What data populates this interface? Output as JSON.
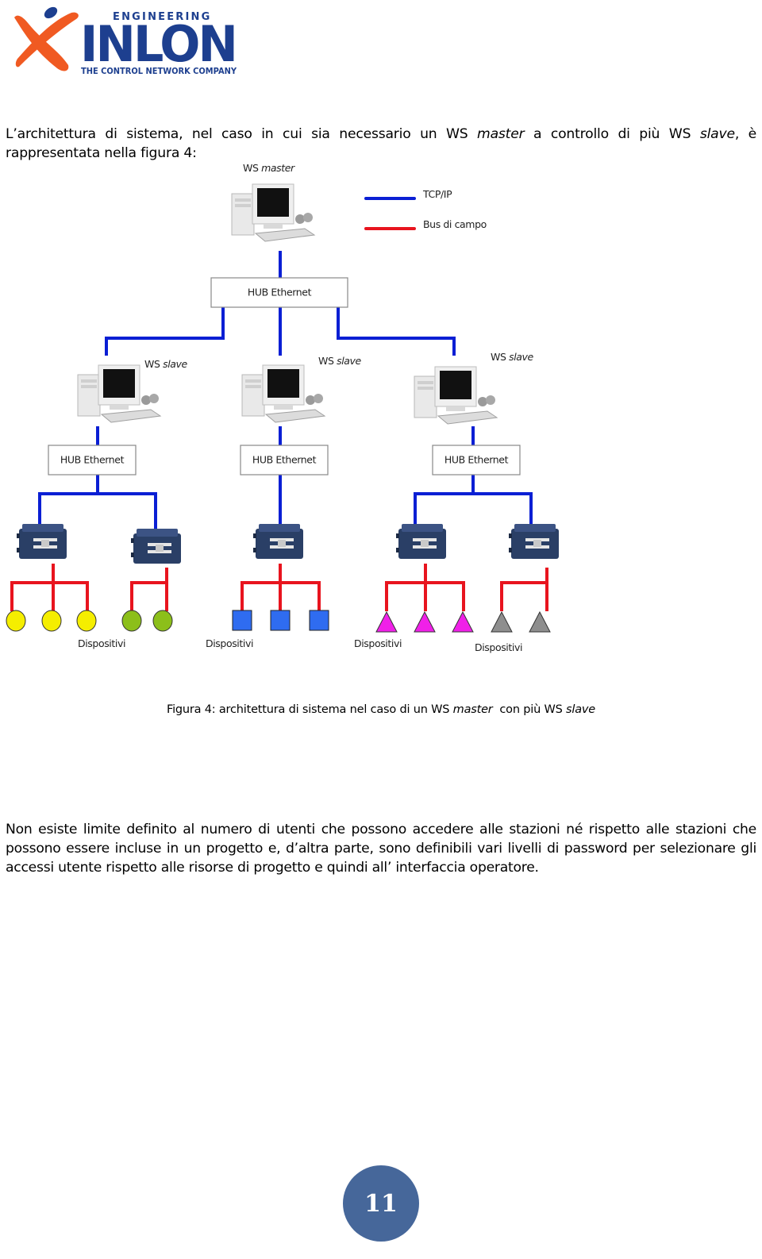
{
  "logo": {
    "tagline_top": "ENGINEERING",
    "name": "INLON",
    "tagline_bottom": "THE CONTROL NETWORK COMPANY",
    "colors": {
      "blue": "#1d3f8f",
      "orange": "#f05a22"
    }
  },
  "intro": {
    "part1": "L’architettura di sistema, nel caso in cui sia necessario un WS ",
    "em1": "master",
    "part2": " a controllo di più WS ",
    "em2": "slave",
    "part3": ", è rappresentata nella figura 4:"
  },
  "diagram": {
    "master_label": {
      "prefix": "WS ",
      "em": "master"
    },
    "legend": [
      {
        "label": "TCP/IP",
        "color": "#0a1fd4"
      },
      {
        "label": "Bus di campo",
        "color": "#e8141e"
      }
    ],
    "main_hub_label": "HUB Ethernet",
    "slaves": [
      {
        "label_prefix": "WS ",
        "label_em": "slave",
        "hub_label": "HUB Ethernet"
      },
      {
        "label_prefix": "WS ",
        "label_em": "slave",
        "hub_label": "HUB Ethernet"
      },
      {
        "label_prefix": "WS ",
        "label_em": "slave",
        "hub_label": "HUB Ethernet"
      }
    ],
    "device_group_labels": [
      "Dispositivi",
      "Dispositivi",
      "Dispositivi",
      "Dispositivi"
    ],
    "device_colors": {
      "yellow": "#f5ee00",
      "green": "#8cbf1a",
      "blue": "#2f6cf0",
      "magenta": "#f020e8",
      "gray": "#8e8e8e"
    }
  },
  "caption": {
    "part1": "Figura 4: architettura di sistema nel caso di un WS ",
    "em1": "master",
    "part2": "  con più WS ",
    "em2": "slave"
  },
  "body_paragraph": "Non esiste limite definito al numero di utenti che possono accedere alle stazioni né rispetto alle stazioni che possono essere incluse in un progetto e, d’altra parte, sono definibili vari livelli di password per selezionare gli accessi utente rispetto alle risorse di progetto e quindi all’ interfaccia operatore.",
  "page_number": "11"
}
